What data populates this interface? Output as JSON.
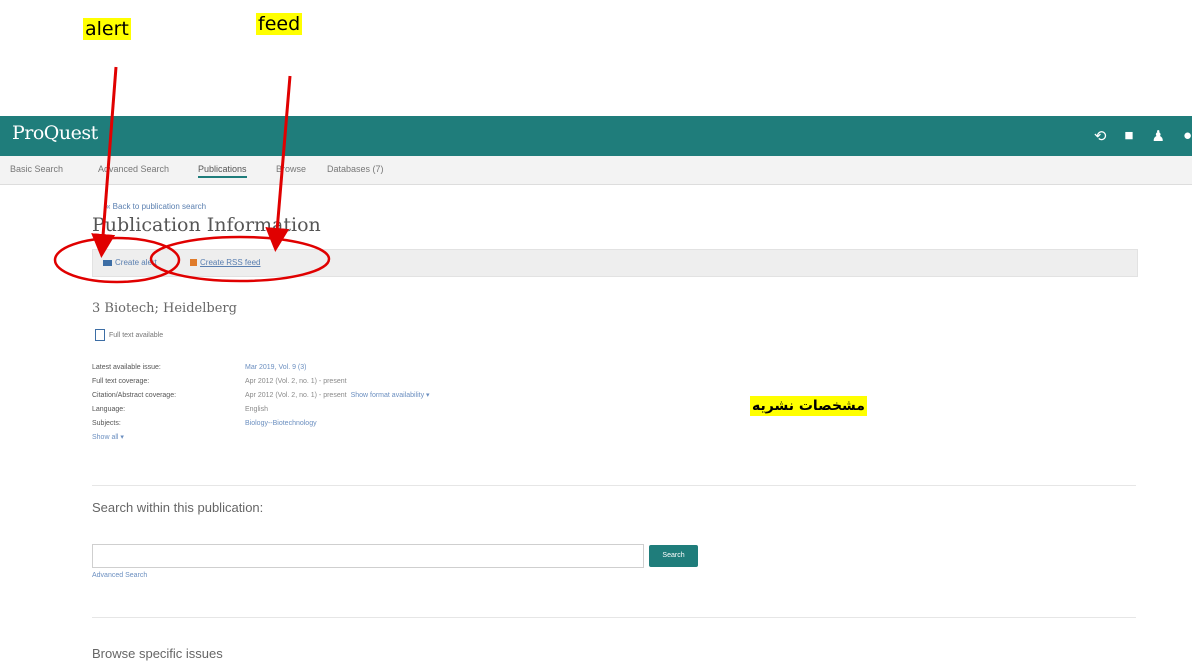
{
  "annotations": {
    "alert_label": "alert",
    "feed_label": "feed",
    "publication_details_label": "مشخصات نشریه",
    "highlight_color": "#ffff00",
    "arrow_color": "#e00000"
  },
  "header": {
    "logo": "ProQuest",
    "icons": [
      "history-icon",
      "folder-icon",
      "user-icon",
      "more-icon"
    ],
    "brand_color": "#1f7d7b"
  },
  "nav": {
    "basic_search": "Basic Search",
    "advanced_search": "Advanced Search",
    "publications": "Publications",
    "browse": "Browse",
    "databases": "Databases (7)"
  },
  "page": {
    "back_link": "« Back to publication search",
    "title": "Publication Information",
    "create_alert": "Create alert",
    "create_rss": "Create RSS feed"
  },
  "publication": {
    "name": "3 Biotech; Heidelberg",
    "full_text": "Full text available",
    "details": [
      {
        "label": "Latest available issue:",
        "value": "Mar 2019, Vol. 9 (3)"
      },
      {
        "label": "Full text coverage:",
        "value": "Apr 2012 (Vol. 2, no. 1) - present"
      },
      {
        "label": "Citation/Abstract coverage:",
        "value": "Apr 2012 (Vol. 2, no. 1) - present",
        "extra": "Show format availability ▾"
      },
      {
        "label": "Language:",
        "value": "English"
      },
      {
        "label": "Subjects:",
        "value": "Biology--Biotechnology"
      }
    ],
    "show_all": "Show all ▾"
  },
  "search": {
    "heading": "Search within this publication:",
    "placeholder": "",
    "button": "Search",
    "advanced": "Advanced Search"
  },
  "browse": {
    "heading": "Browse specific issues"
  }
}
